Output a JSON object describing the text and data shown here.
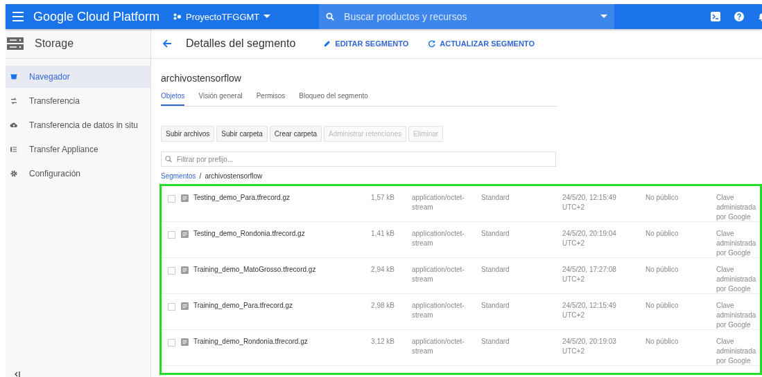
{
  "top_bar": {
    "title": "Google Cloud Platform",
    "project": "ProyectoTFGGMT",
    "search": {
      "placeholder": "Buscar productos y recursos"
    }
  },
  "sidebar": {
    "title": "Storage",
    "items": [
      {
        "label": "Navegador",
        "selected": true
      },
      {
        "label": "Transferencia",
        "selected": false
      },
      {
        "label": "Transferencia de datos in situ",
        "selected": false
      },
      {
        "label": "Transfer Appliance",
        "selected": false
      },
      {
        "label": "Configuración",
        "selected": false
      }
    ]
  },
  "header": {
    "title": "Detalles del segmento",
    "actions": [
      {
        "label": "EDITAR SEGMENTO"
      },
      {
        "label": "ACTUALIZAR SEGMENTO"
      }
    ]
  },
  "bucket_name": "archivostensorflow",
  "tabs": [
    {
      "label": "Objetos",
      "selected": true
    },
    {
      "label": "Visión general",
      "selected": false
    },
    {
      "label": "Permisos",
      "selected": false
    },
    {
      "label": "Bloqueo del segmento",
      "selected": false
    }
  ],
  "toolbar": [
    {
      "label": "Subir archivos",
      "disabled": false
    },
    {
      "label": "Subir carpeta",
      "disabled": false
    },
    {
      "label": "Crear carpeta",
      "disabled": false
    },
    {
      "label": "Administrar retenciones",
      "disabled": true
    },
    {
      "label": "Eliminar",
      "disabled": true
    }
  ],
  "filter": {
    "placeholder": "Filtrar por prefijo..."
  },
  "breadcrumb": {
    "link": "Segmentos",
    "separator": "/",
    "current": "archivostensorflow"
  },
  "table": {
    "rows": [
      {
        "checked": false,
        "name": "Testing_demo_Para.tfrecord.gz",
        "size": "1,57 kB",
        "type": "application/octet-stream",
        "storage": "Standard",
        "date": "24/5/20, 12:15:49 UTC+2",
        "access": "No público",
        "encryption": "Clave administrada por Google"
      },
      {
        "checked": false,
        "name": "Testing_demo_Rondonia.tfrecord.gz",
        "size": "1,41 kB",
        "type": "application/octet-stream",
        "storage": "Standard",
        "date": "24/5/20, 20:19:04 UTC+2",
        "access": "No público",
        "encryption": "Clave administrada por Google"
      },
      {
        "checked": false,
        "name": "Training_demo_MatoGrosso.tfrecord.gz",
        "size": "2,94 kB",
        "type": "application/octet-stream",
        "storage": "Standard",
        "date": "24/5/20, 17:27:08 UTC+2",
        "access": "No público",
        "encryption": "Clave administrada por Google"
      },
      {
        "checked": false,
        "name": "Training_demo_Para.tfrecord.gz",
        "size": "2,98 kB",
        "type": "application/octet-stream",
        "storage": "Standard",
        "date": "24/5/20, 12:15:49 UTC+2",
        "access": "No público",
        "encryption": "Clave administrada por Google"
      },
      {
        "checked": false,
        "name": "Training_demo_Rondonia.tfrecord.gz",
        "size": "3,12 kB",
        "type": "application/octet-stream",
        "storage": "Standard",
        "date": "24/5/20, 20:19:03 UTC+2",
        "access": "No público",
        "encryption": "Clave administrada por Google"
      }
    ]
  }
}
